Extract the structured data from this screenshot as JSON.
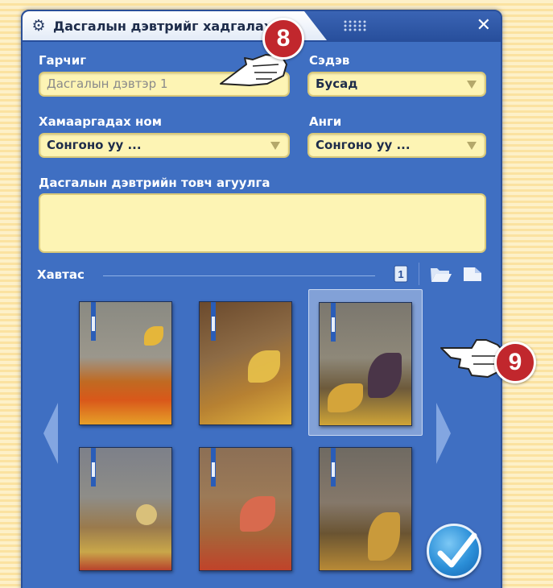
{
  "window": {
    "title": "Дасгалын дэвтрийг хадгалах",
    "close": "✕"
  },
  "form": {
    "title_label": "Гарчиг",
    "title_placeholder": "Дасгалын дэвтэр 1",
    "topic_label": "Сэдэв",
    "topic_value": "Бусад",
    "book_label": "Хамааргадах ном",
    "book_value": "Сонгоно уу ...",
    "grade_label": "Анги",
    "grade_value": "Сонгоно уу ...",
    "summary_label": "Дасгалын дэвтрийн товч агуулга",
    "summary_value": ""
  },
  "covers": {
    "section_label": "Хавтас",
    "page_indicator": "1",
    "items": [
      {
        "theme": "autumn-leaves-orange",
        "selected": false
      },
      {
        "theme": "autumn-leaves-gold",
        "selected": false
      },
      {
        "theme": "dark-leaves-wood",
        "selected": true
      },
      {
        "theme": "acorns-berries",
        "selected": false
      },
      {
        "theme": "red-leaves-planks",
        "selected": false
      },
      {
        "theme": "brown-leaves-bark",
        "selected": false
      }
    ]
  },
  "annotations": {
    "step_a": "8",
    "step_b": "9"
  },
  "colors": {
    "panel": "#3f6fc2",
    "field": "#fdf4b4",
    "badge": "#c1272d",
    "background_stripe": "#fbe2a0"
  },
  "icons": [
    "gear-icon",
    "grip-icon",
    "close-icon",
    "page-icon",
    "folder-open-icon",
    "new-page-icon",
    "arrow-left-icon",
    "arrow-right-icon",
    "check-icon",
    "pointing-hand-icon"
  ]
}
